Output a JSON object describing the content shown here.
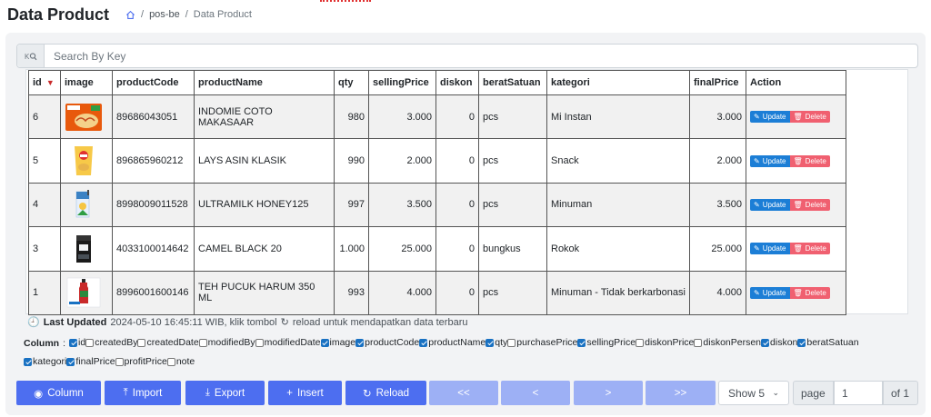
{
  "header": {
    "title": "Data Product",
    "breadcrumb": {
      "sep1": "/",
      "project": "pos-be",
      "sep2": "/",
      "current": "Data Product"
    }
  },
  "search": {
    "placeholder": "Search By Key",
    "value": ""
  },
  "table": {
    "columns": [
      "id",
      "image",
      "productCode",
      "productName",
      "qty",
      "sellingPrice",
      "diskon",
      "beratSatuan",
      "kategori",
      "finalPrice",
      "Action"
    ],
    "sort_indicator": "▼",
    "rows": [
      {
        "id": "6",
        "productCode": "89686043051",
        "productName": "INDOMIE COTO MAKASAAR",
        "qty": "980",
        "sellingPrice": "3.000",
        "diskon": "0",
        "beratSatuan": "pcs",
        "kategori": "Mi Instan",
        "finalPrice": "3.000"
      },
      {
        "id": "5",
        "productCode": "896865960212",
        "productName": "LAYS ASIN KLASIK",
        "qty": "990",
        "sellingPrice": "2.000",
        "diskon": "0",
        "beratSatuan": "pcs",
        "kategori": "Snack",
        "finalPrice": "2.000"
      },
      {
        "id": "4",
        "productCode": "8998009011528",
        "productName": "ULTRAMILK HONEY125",
        "qty": "997",
        "sellingPrice": "3.500",
        "diskon": "0",
        "beratSatuan": "pcs",
        "kategori": "Minuman",
        "finalPrice": "3.500"
      },
      {
        "id": "3",
        "productCode": "4033100014642",
        "productName": "CAMEL BLACK 20",
        "qty": "1.000",
        "sellingPrice": "25.000",
        "diskon": "0",
        "beratSatuan": "bungkus",
        "kategori": "Rokok",
        "finalPrice": "25.000"
      },
      {
        "id": "1",
        "productCode": "8996001600146",
        "productName": "TEH PUCUK HARUM 350 ML",
        "qty": "993",
        "sellingPrice": "4.000",
        "diskon": "0",
        "beratSatuan": "pcs",
        "kategori": "Minuman - Tidak berkarbonasi",
        "finalPrice": "4.000"
      }
    ],
    "update_label": "Update",
    "delete_label": "Delete"
  },
  "last_updated": {
    "label": "Last Updated",
    "text": "2024-05-10 16:45:11 WIB, klik tombol",
    "suffix": "reload untuk mendapatkan data terbaru"
  },
  "column_toggle": {
    "label": "Column",
    "colon": ":",
    "options": [
      {
        "name": "id",
        "checked": true
      },
      {
        "name": "createdBy",
        "checked": false
      },
      {
        "name": "createdDate",
        "checked": false
      },
      {
        "name": "modifiedBy",
        "checked": false
      },
      {
        "name": "modifiedDate",
        "checked": false
      },
      {
        "name": "image",
        "checked": true
      },
      {
        "name": "productCode",
        "checked": true
      },
      {
        "name": "productName",
        "checked": true
      },
      {
        "name": "qty",
        "checked": true
      },
      {
        "name": "purchasePrice",
        "checked": false
      },
      {
        "name": "sellingPrice",
        "checked": true
      },
      {
        "name": "diskonPrice",
        "checked": false
      },
      {
        "name": "diskonPersen",
        "checked": false
      },
      {
        "name": "diskon",
        "checked": true
      },
      {
        "name": "beratSatuan",
        "checked": true
      },
      {
        "name": "kategori",
        "checked": true
      },
      {
        "name": "finalPrice",
        "checked": true
      },
      {
        "name": "profitPrice",
        "checked": false
      },
      {
        "name": "note",
        "checked": false
      }
    ]
  },
  "toolbar": {
    "column": "Column",
    "import": "Import",
    "export": "Export",
    "insert": "Insert",
    "reload": "Reload",
    "first": "<<",
    "prev": "<",
    "next": ">",
    "last": ">>"
  },
  "pagination": {
    "show_value": "Show 5",
    "page_label": "page",
    "page_value": "1",
    "of_label": "of 1"
  },
  "colors": {
    "primary_button": "#4d6ef0",
    "pager_button": "#9db0f5",
    "update_button": "#1c7ed6",
    "delete_button": "#f06070",
    "panel_bg": "#f2f3f5"
  }
}
